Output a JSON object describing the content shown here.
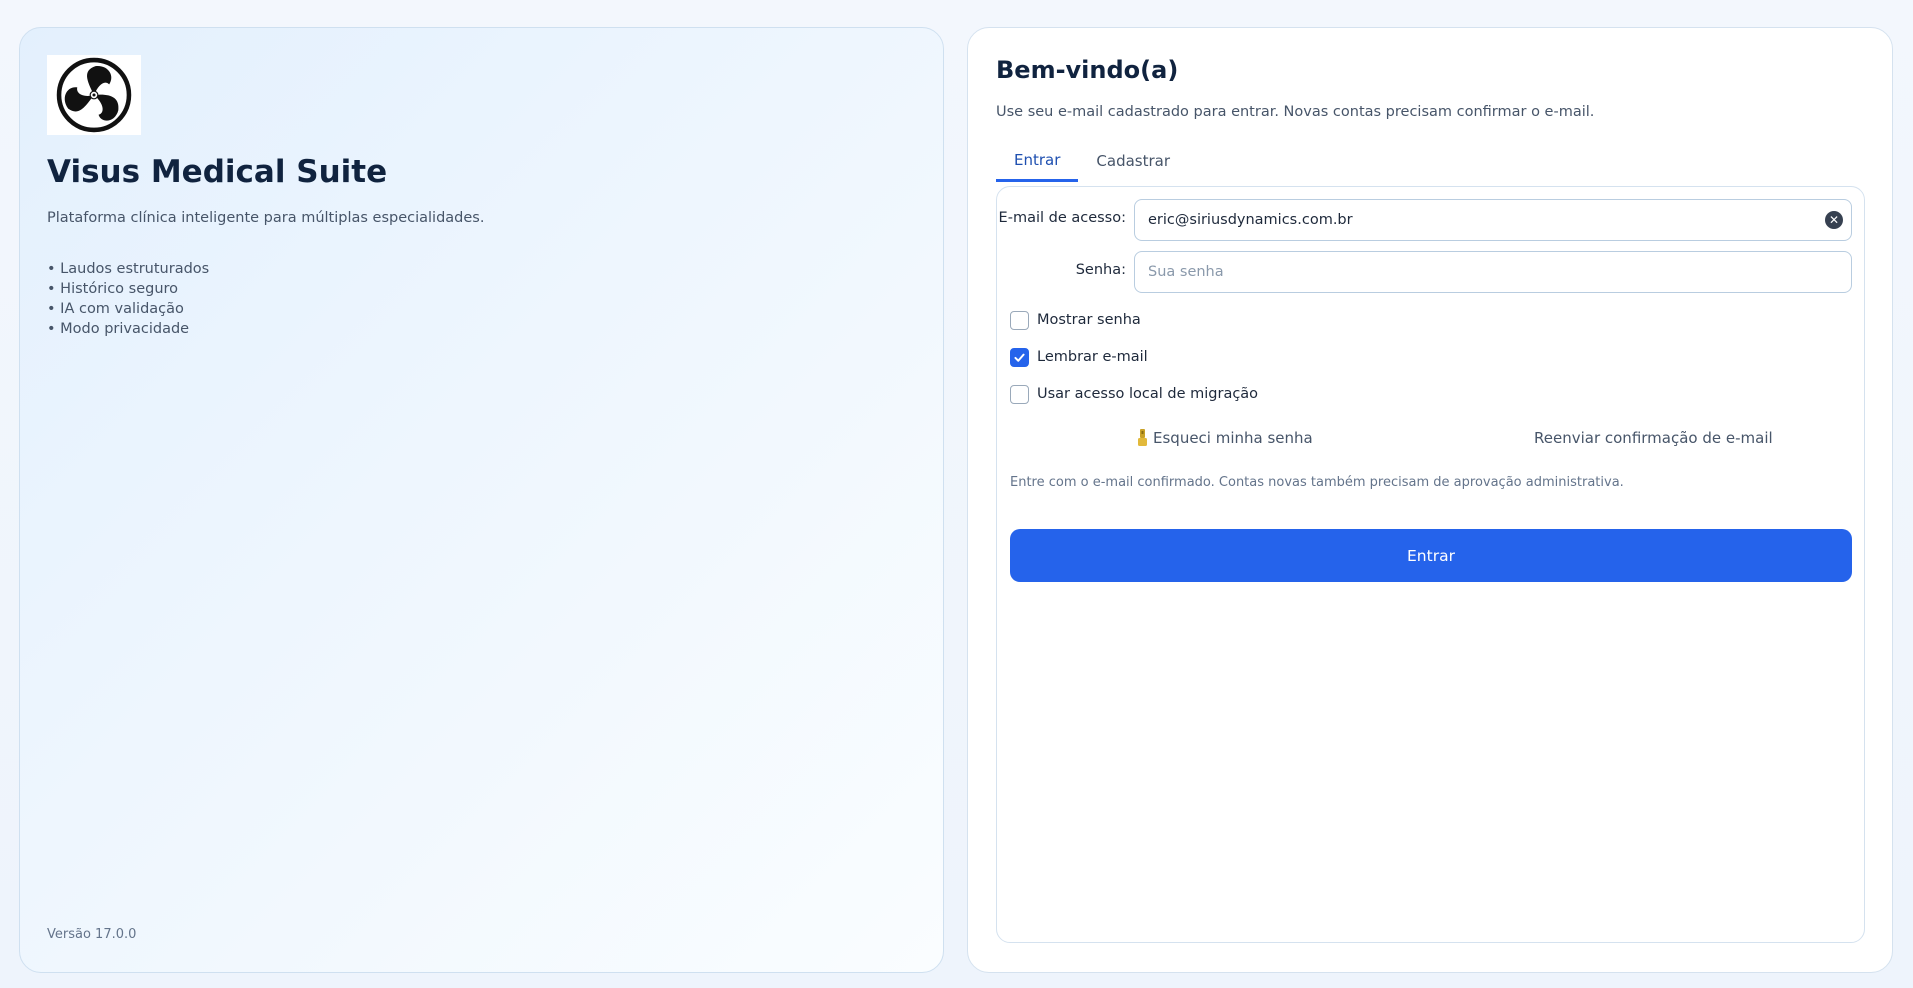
{
  "brand": {
    "title": "Visus Medical Suite",
    "subtitle": "Plataforma clínica inteligente para múltiplas especialidades.",
    "features": [
      "• Laudos estruturados",
      "• Histórico seguro",
      "• IA com validação",
      "• Modo privacidade"
    ],
    "version": "Versão 17.0.0",
    "logo_icon": "triskelion-logo-icon"
  },
  "login": {
    "heading": "Bem-vindo(a)",
    "subheading": "Use seu e-mail cadastrado para entrar. Novas contas precisam confirmar o e-mail.",
    "tabs": [
      {
        "label": "Entrar",
        "active": true
      },
      {
        "label": "Cadastrar",
        "active": false
      }
    ],
    "email": {
      "label": "E-mail de acesso:",
      "value": "eric@siriusdynamics.com.br",
      "placeholder": ""
    },
    "password": {
      "label": "Senha:",
      "value": "",
      "placeholder": "Sua senha"
    },
    "options": [
      {
        "label": "Mostrar senha",
        "checked": false
      },
      {
        "label": "Lembrar e-mail",
        "checked": true
      },
      {
        "label": "Usar acesso local de migração",
        "checked": false
      }
    ],
    "forgot_label": "Esqueci minha senha",
    "forgot_icon": "key-icon",
    "resend_label": "Reenviar confirmação de e-mail",
    "note": "Entre com o e-mail confirmado. Contas novas também precisam de aprovação administrativa.",
    "submit_label": "Entrar"
  },
  "colors": {
    "accent": "#2563eb",
    "title": "#10233f"
  }
}
